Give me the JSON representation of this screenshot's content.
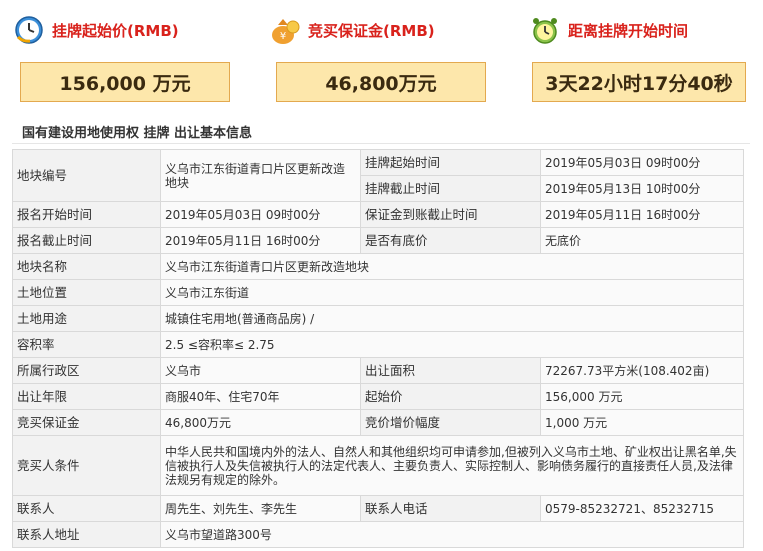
{
  "metrics": {
    "start_price": {
      "label": "挂牌起始价(RMB)",
      "value": "156,000 万元",
      "icon": "clock-icon"
    },
    "deposit": {
      "label": "竞买保证金(RMB)",
      "value": "46,800万元",
      "icon": "money-bag-icon"
    },
    "countdown": {
      "label": "距离挂牌开始时间",
      "value": "3天22小时17分40秒",
      "icon": "alarm-clock-icon"
    }
  },
  "section_title": "国有建设用地使用权 挂牌 出让基本信息",
  "table": {
    "plot_no": {
      "k": "地块编号",
      "v": "义乌市江东街道青口片区更新改造地块"
    },
    "listing_start": {
      "k": "挂牌起始时间",
      "v": "2019年05月03日 09时00分"
    },
    "listing_end": {
      "k": "挂牌截止时间",
      "v": "2019年05月13日 10时00分"
    },
    "reg_start": {
      "k": "报名开始时间",
      "v": "2019年05月03日 09时00分"
    },
    "deposit_deadline": {
      "k": "保证金到账截止时间",
      "v": "2019年05月11日 16时00分"
    },
    "reg_end": {
      "k": "报名截止时间",
      "v": "2019年05月11日 16时00分"
    },
    "reserve": {
      "k": "是否有底价",
      "v": "无底价"
    },
    "plot_name": {
      "k": "地块名称",
      "v": "义乌市江东街道青口片区更新改造地块"
    },
    "location": {
      "k": "土地位置",
      "v": "义乌市江东街道"
    },
    "usage": {
      "k": "土地用途",
      "v": "城镇住宅用地(普通商品房) /"
    },
    "far": {
      "k": "容积率",
      "v": "2.5 ≤容积率≤ 2.75"
    },
    "district": {
      "k": "所属行政区",
      "v": "义乌市"
    },
    "area": {
      "k": "出让面积",
      "v": "72267.73平方米(108.402亩)"
    },
    "term": {
      "k": "出让年限",
      "v": "商服40年、住宅70年"
    },
    "start_price": {
      "k": "起始价",
      "v": "156,000 万元"
    },
    "deposit": {
      "k": "竞买保证金",
      "v": "46,800万元"
    },
    "increment": {
      "k": "竞价增价幅度",
      "v": "1,000 万元"
    },
    "conditions": {
      "k": "竞买人条件",
      "v": "中华人民共和国境内外的法人、自然人和其他组织均可申请参加,但被列入义乌市土地、矿业权出让黑名单,失信被执行人及失信被执行人的法定代表人、主要负责人、实际控制人、影响债务履行的直接责任人员,及法律法规另有规定的除外。"
    },
    "contact": {
      "k": "联系人",
      "v": "周先生、刘先生、李先生"
    },
    "phone": {
      "k": "联系人电话",
      "v": "0579-85232721、85232715"
    },
    "address": {
      "k": "联系人地址",
      "v": "义乌市望道路300号"
    }
  }
}
